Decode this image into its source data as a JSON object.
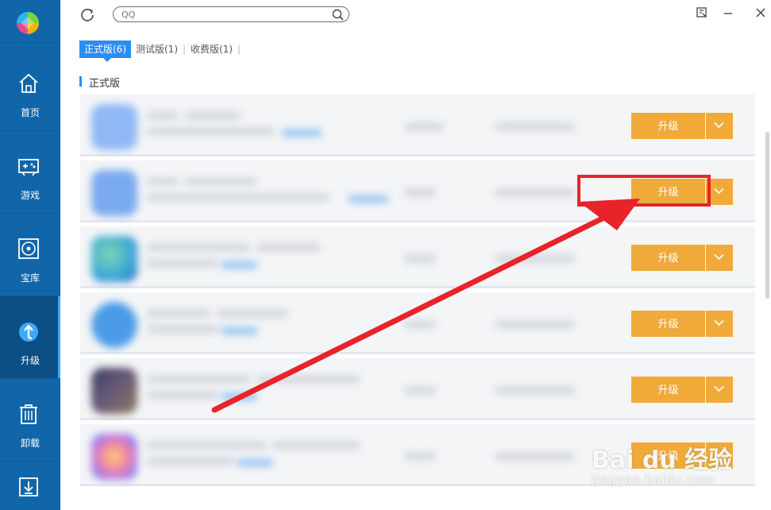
{
  "sidebar": {
    "items": [
      {
        "label": "首页",
        "icon": "home-icon"
      },
      {
        "label": "游戏",
        "icon": "gamepad-icon"
      },
      {
        "label": "宝库",
        "icon": "disc-icon"
      },
      {
        "label": "升级",
        "icon": "upgrade-arrow-icon",
        "active": true
      },
      {
        "label": "卸载",
        "icon": "trash-icon"
      },
      {
        "label": "",
        "icon": "download-icon"
      }
    ]
  },
  "topbar": {
    "search_placeholder": "QQ"
  },
  "tabs": [
    {
      "label": "正式版(6)",
      "active": true
    },
    {
      "label": "测试版(1)",
      "active": false
    },
    {
      "label": "收费版(1)",
      "active": false
    }
  ],
  "section_title": "正式版",
  "rows": [
    {
      "button_label": "升级",
      "icon_color": "#8fb8f5"
    },
    {
      "button_label": "升级",
      "icon_color": "#7aaaf0"
    },
    {
      "button_label": "升级",
      "icon_color": "#3aa6d8"
    },
    {
      "button_label": "升级",
      "icon_color": "#4b9be8"
    },
    {
      "button_label": "升级",
      "icon_color": "#5a4f7a"
    },
    {
      "button_label": "升级",
      "icon_color": "#e86fb5"
    }
  ],
  "colors": {
    "sidebar": "#1166a9",
    "accent": "#2d8cf0",
    "upgrade_button": "#f0aa3a",
    "annotation": "#e8232a"
  },
  "watermark": {
    "main": "Bai du 经验",
    "sub": "jingyan.baidu.com"
  }
}
